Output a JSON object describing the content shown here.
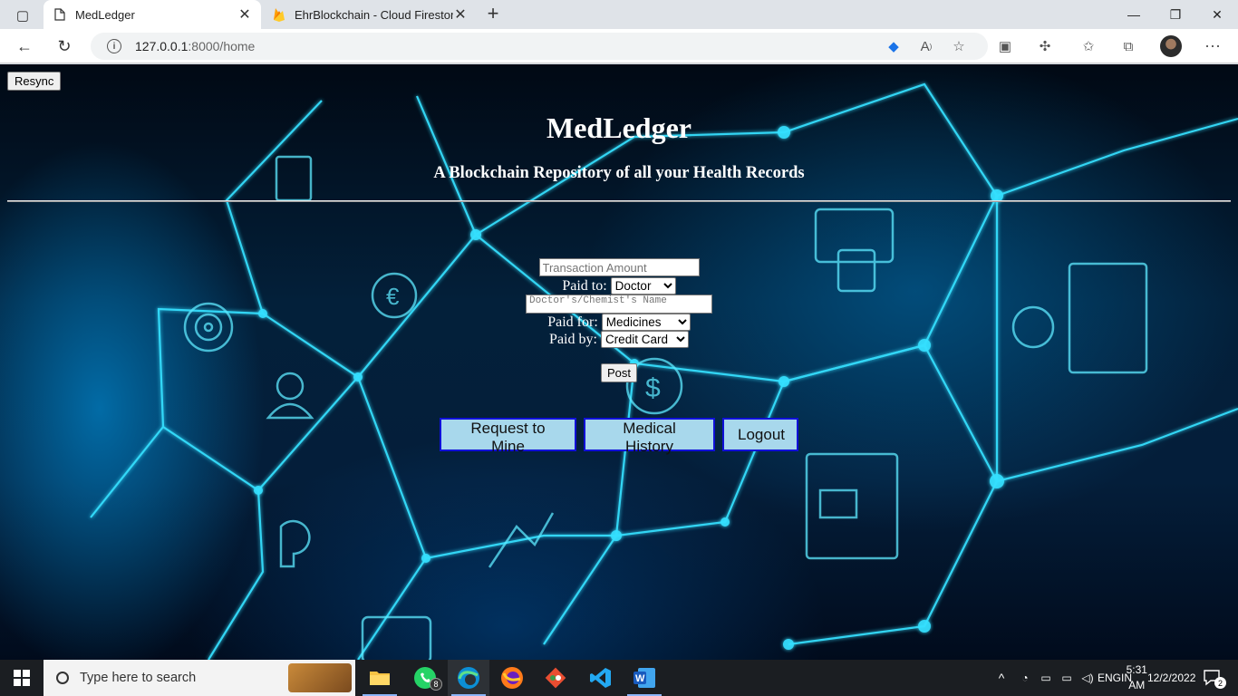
{
  "browser": {
    "tabs": [
      {
        "title": "MedLedger",
        "active": true
      },
      {
        "title": "EhrBlockchain - Cloud Firestore -",
        "active": false
      }
    ],
    "address": {
      "host": "127.0.0.1",
      "path": ":8000/home"
    }
  },
  "page": {
    "resync_label": "Resync",
    "title": "MedLedger",
    "subtitle": "A Blockchain Repository of all your Health Records",
    "form": {
      "amount_placeholder": "Transaction Amount",
      "paid_to_label": "Paid to:",
      "paid_to_value": "Doctor",
      "name_placeholder": "Doctor's/Chemist's Name",
      "paid_for_label": "Paid for:",
      "paid_for_value": "Medicines",
      "paid_by_label": "Paid by:",
      "paid_by_value": "Credit Card",
      "post_label": "Post"
    },
    "buttons": {
      "request_mine": "Request to Mine",
      "medical_history": "Medical History",
      "logout": "Logout"
    }
  },
  "taskbar": {
    "search_placeholder": "Type here to search",
    "whatsapp_badge": "8",
    "language": "ENG",
    "region": "IN",
    "time": "5:31 AM",
    "date": "12/2/2022",
    "notification_count": "2"
  },
  "colors": {
    "button_fill": "#a8d8ec",
    "button_border": "#1010d8",
    "page_background": "#03203a",
    "glow": "#36e0ff"
  }
}
